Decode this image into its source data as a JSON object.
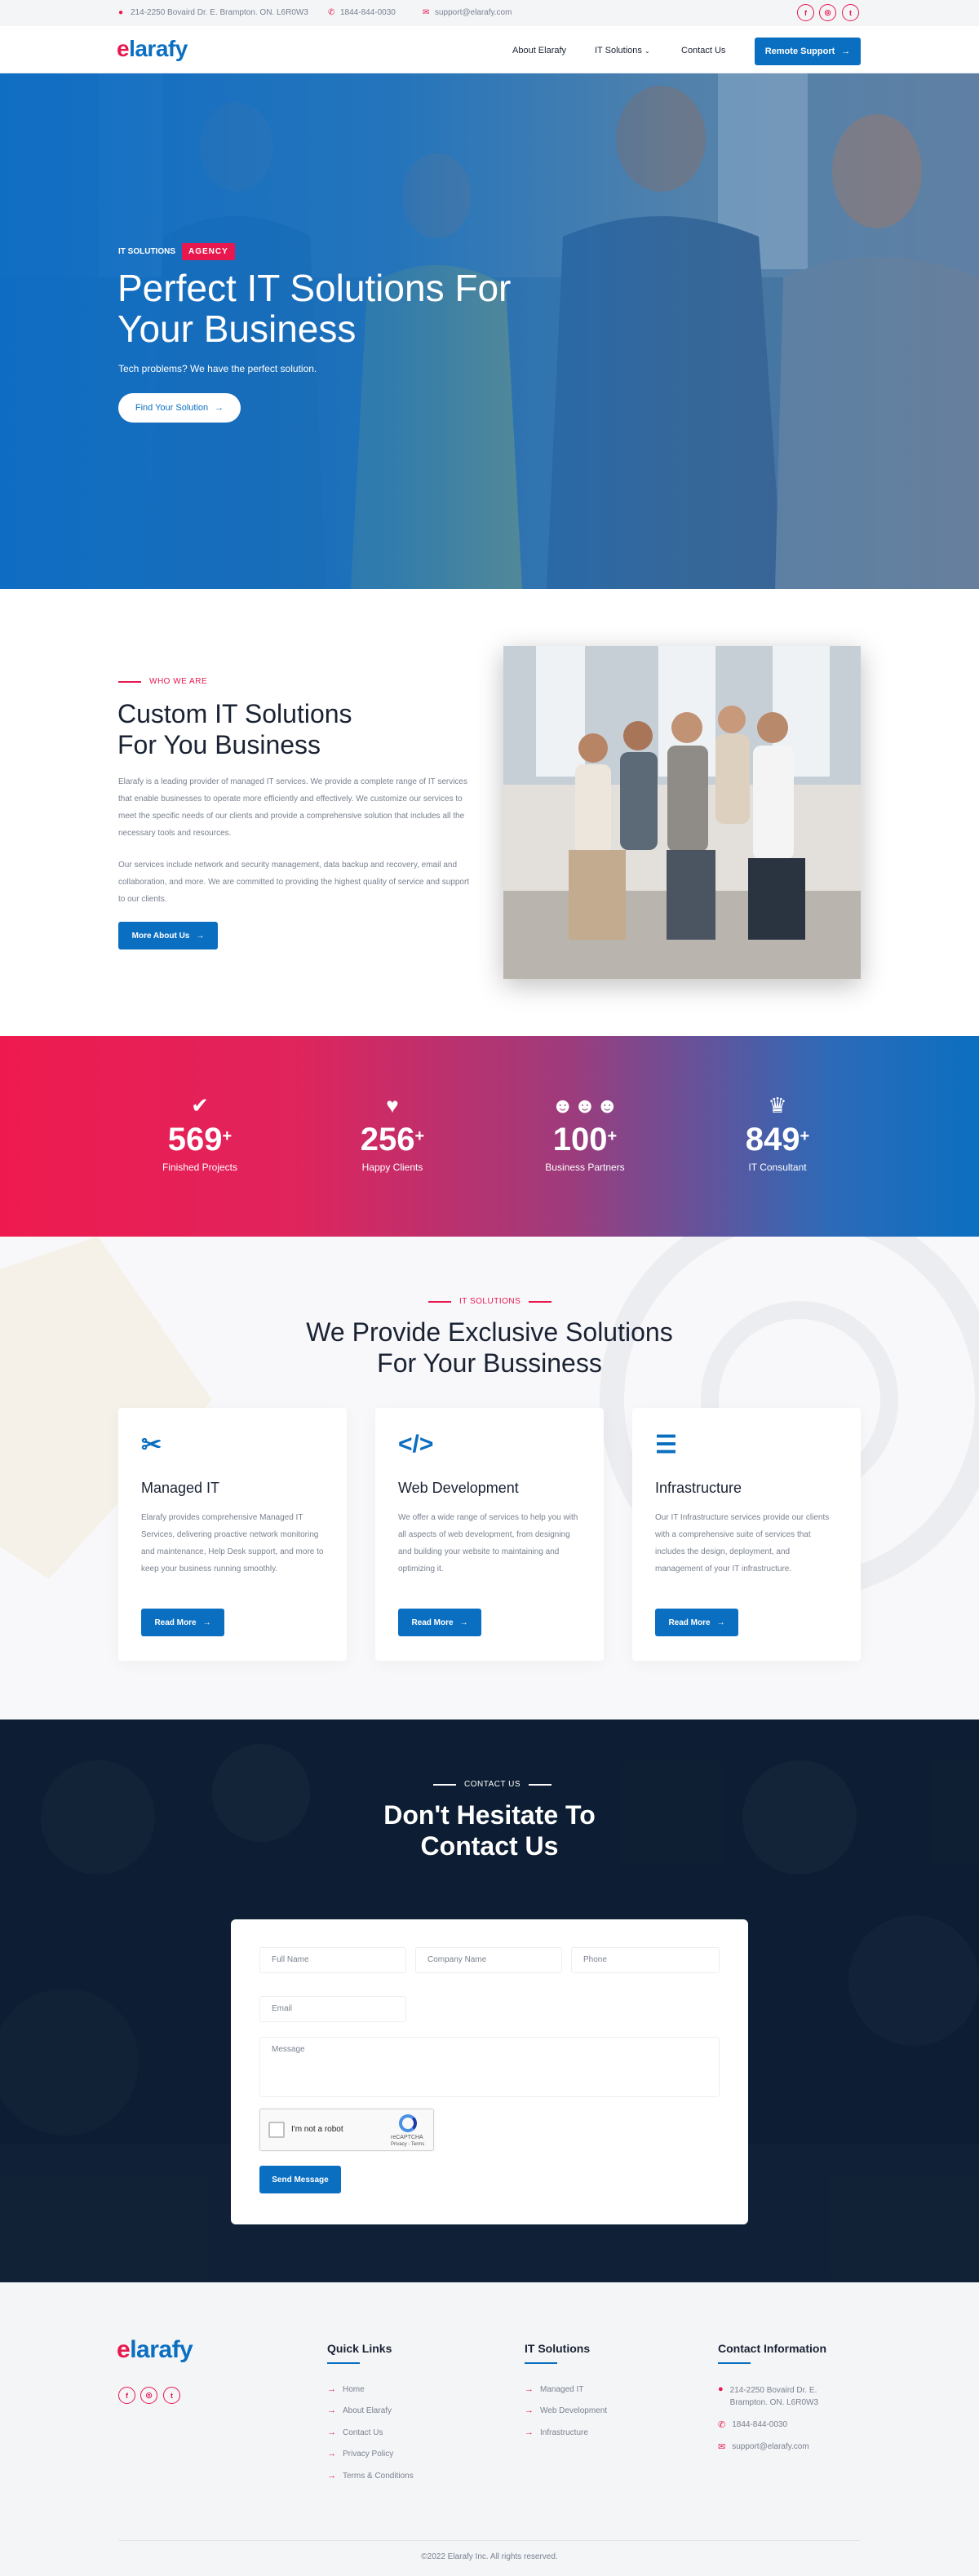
{
  "topbar": {
    "address": "214-2250 Bovaird Dr. E. Brampton. ON. L6R0W3",
    "phone": "1844-844-0030",
    "email": "support@elarafy.com",
    "social": [
      "f",
      "◎",
      "t"
    ]
  },
  "nav": {
    "logo_e": "e",
    "logo_rest": "larafy",
    "links": [
      "About Elarafy",
      "IT Solutions",
      "Contact Us"
    ],
    "cta": "Remote Support"
  },
  "hero": {
    "tag": "IT SOLUTIONS",
    "badge": "AGENCY",
    "title": "Perfect IT Solutions For Your Business",
    "subtitle": "Tech problems? We have the perfect solution.",
    "button": "Find Your Solution"
  },
  "about": {
    "eyebrow": "WHO WE ARE",
    "title_line1": "Custom IT Solutions",
    "title_line2": "For You Business",
    "para1": "Elarafy is a leading provider of managed IT services. We provide a complete range of IT services that enable businesses to operate more efficiently and effectively. We customize our services to meet the specific needs of our clients and provide a comprehensive solution that includes all the necessary tools and resources.",
    "para2": "Our services include network and security management, data backup and recovery, email and collaboration, and more. We are committed to providing the highest quality of service and support to our clients.",
    "button": "More About Us"
  },
  "stats": [
    {
      "value": "569",
      "label": "Finished Projects",
      "icon": "check-icon"
    },
    {
      "value": "256",
      "label": "Happy Clients",
      "icon": "heart-icon"
    },
    {
      "value": "100",
      "label": "Business Partners",
      "icon": "users-icon"
    },
    {
      "value": "849",
      "label": "IT Consultant",
      "icon": "trophy-icon"
    }
  ],
  "stat_plus": "+",
  "services": {
    "eyebrow": "IT SOLUTIONS",
    "title_line1": "We Provide Exclusive Solutions",
    "title_line2": "For Your Bussiness",
    "cards": [
      {
        "title": "Managed IT",
        "text": "Elarafy provides comprehensive Managed IT Services, delivering proactive network monitoring and maintenance, Help Desk support, and more to keep your business running smoothly.",
        "button": "Read More",
        "icon": "tools-icon"
      },
      {
        "title": "Web Development",
        "text": "We offer a wide range of services to help you with all aspects of web development, from designing and building your website to maintaining and optimizing it.",
        "button": "Read More",
        "icon": "code-icon"
      },
      {
        "title": "Infrastructure",
        "text": "Our IT Infrastructure services provide our clients with a comprehensive suite of services that includes the design, deployment, and management of your IT infrastructure.",
        "button": "Read More",
        "icon": "database-icon"
      }
    ]
  },
  "contact": {
    "eyebrow": "CONTACT US",
    "title_line1": "Don't Hesitate To",
    "title_line2": "Contact Us",
    "placeholders": {
      "full_name": "Full Name",
      "company": "Company Name",
      "phone": "Phone",
      "email": "Email",
      "message": "Message"
    },
    "captcha_label": "I'm not a robot",
    "captcha_brand": "reCAPTCHA",
    "captcha_terms": "Privacy - Terms",
    "submit": "Send Message"
  },
  "footer": {
    "quick_links_title": "Quick Links",
    "quick_links": [
      "Home",
      "About Elarafy",
      "Contact Us",
      "Privacy Policy",
      "Terms & Conditions"
    ],
    "it_title": "IT Solutions",
    "it_links": [
      "Managed IT",
      "Web Development",
      "Infrastructure"
    ],
    "contact_title": "Contact Information",
    "address": "214-2250 Bovaird Dr. E. Brampton. ON. L6R0W3",
    "phone": "1844-844-0030",
    "email": "support@elarafy.com",
    "copyright": "©2022 Elarafy Inc. All rights reserved."
  },
  "colors": {
    "brand_blue": "#0b6fc1",
    "brand_red": "#e8184f",
    "dark": "#0e1f34"
  }
}
